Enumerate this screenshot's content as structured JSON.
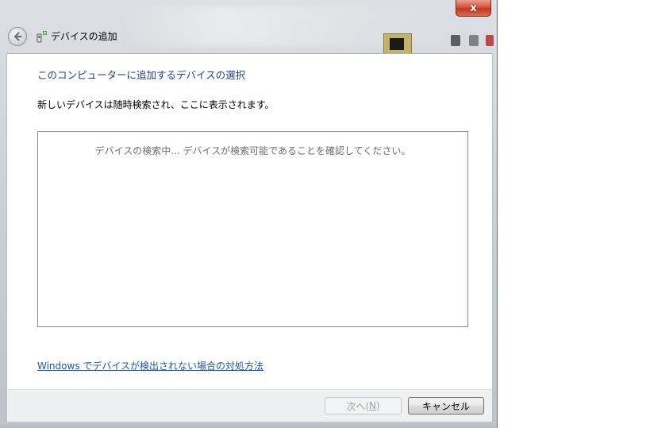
{
  "window": {
    "title": "デバイスの追加",
    "close_label": "x"
  },
  "content": {
    "main_instruction": "このコンピューターに追加するデバイスの選択",
    "description": "新しいデバイスは随時検索され、ここに表示されます。",
    "device_list": {
      "status_text": "デバイスの検索中... デバイスが検索可能であることを確認してください。"
    },
    "help_link": "Windows でデバイスが検出されない場合の対処方法"
  },
  "footer": {
    "next_label": "次へ(",
    "next_mnemonic": "N",
    "next_suffix": ")",
    "cancel_label": "キャンセル"
  },
  "colors": {
    "instruction_blue": "#1c3f94",
    "link_blue": "#1c56b4",
    "close_red": "#c23a22"
  },
  "icons": {
    "back": "back-arrow-icon",
    "title": "device-add-icon",
    "close": "close-icon"
  }
}
